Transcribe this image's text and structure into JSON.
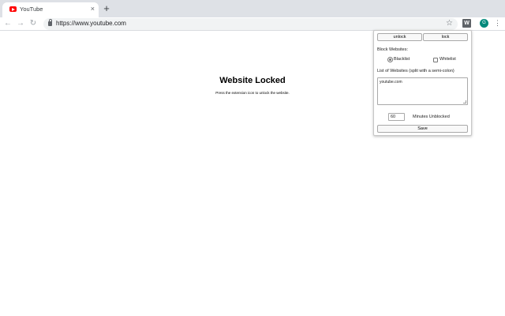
{
  "tab": {
    "title": "YouTube",
    "close": "×",
    "new_tab": "+"
  },
  "toolbar": {
    "back": "←",
    "forward": "→",
    "reload": "↻",
    "url": "https://www.youtube.com",
    "bookmark": "☆",
    "extension_letter": "W",
    "avatar_letter": "G",
    "menu": "⋮"
  },
  "page": {
    "title": "Website Locked",
    "subtitle": "Press the extension icon to unlock the website."
  },
  "popup": {
    "unlock_label": "unlock",
    "lock_label": "lock",
    "block_label": "Block Websites:",
    "blacklist_label": "Blacklist",
    "whitelist_label": "Whitelist",
    "list_label": "List of Websites (split with a semi-colon)",
    "websites": "youtube.com",
    "minutes_value": "60",
    "minutes_label": "Minutes Unblocked",
    "save_label": "Save",
    "blacklist_checked": true,
    "whitelist_checked": false
  },
  "colors": {
    "tabstrip": "#dee1e6",
    "youtube_red": "#ff0000",
    "avatar": "#00897b"
  }
}
